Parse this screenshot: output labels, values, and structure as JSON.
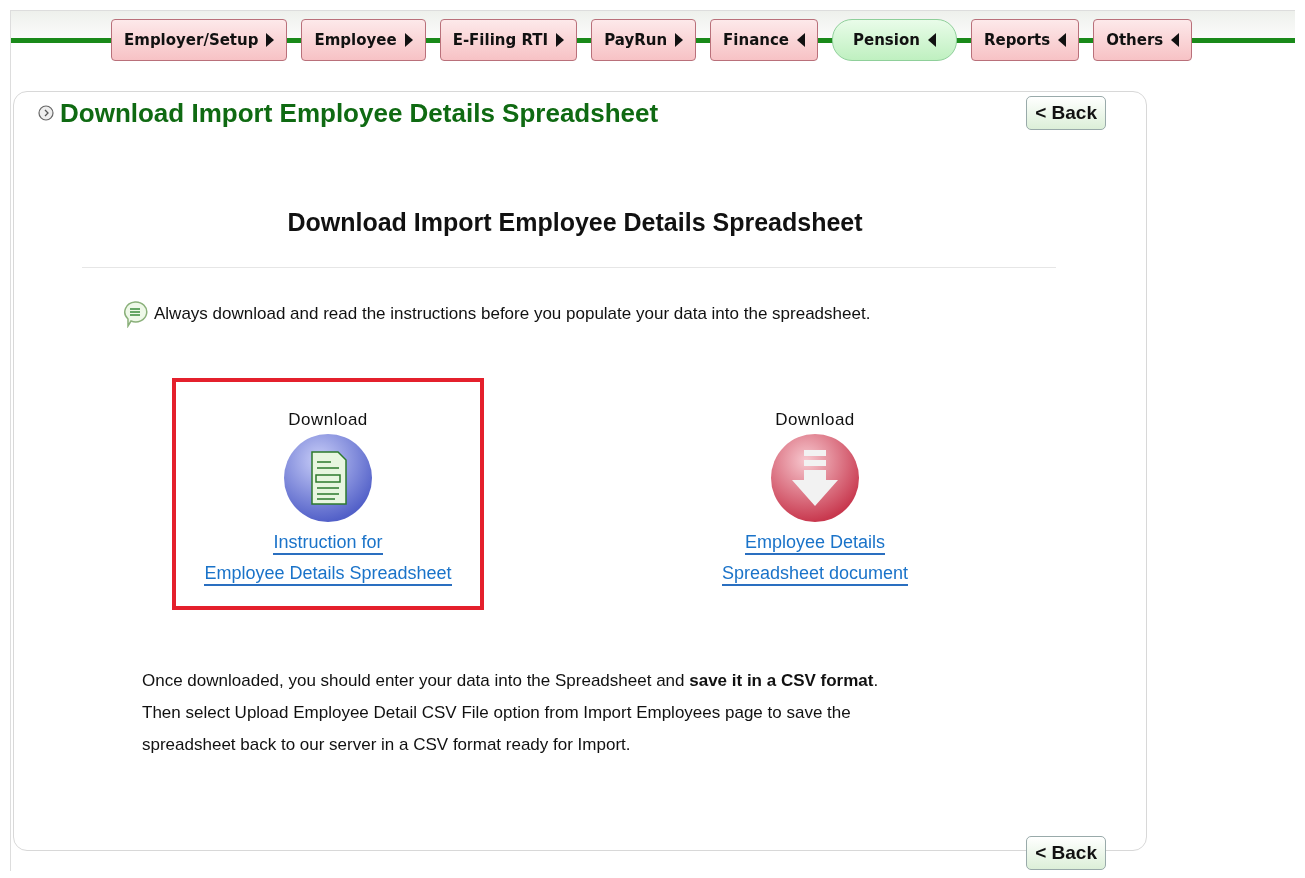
{
  "nav_tabs": [
    {
      "label": "Employer/Setup",
      "kind": "right",
      "selected": false
    },
    {
      "label": "Employee",
      "kind": "right",
      "selected": false
    },
    {
      "label": "E-Filing RTI",
      "kind": "right",
      "selected": false
    },
    {
      "label": "PayRun",
      "kind": "right",
      "selected": false
    },
    {
      "label": "Finance",
      "kind": "left",
      "selected": false
    },
    {
      "label": "Pension",
      "kind": "left",
      "selected": true
    },
    {
      "label": "Reports",
      "kind": "left",
      "selected": false
    },
    {
      "label": "Others",
      "kind": "left",
      "selected": false
    }
  ],
  "page_title": "Download Import Employee Details Spreadsheet",
  "back_button_top": "< Back",
  "heading": "Download Import Employee Details Spreadsheet",
  "note": "Always download and read the instructions before you populate your data into the spreadsheet.",
  "downloads": [
    {
      "caption": "Download",
      "kind": "document",
      "highlighted": true,
      "link_lines": [
        "Instruction for",
        "Employee Details Spreadsheet"
      ]
    },
    {
      "caption": "Download",
      "kind": "arrow",
      "highlighted": false,
      "link_lines": [
        "Employee Details",
        "Spreadsheet document"
      ]
    }
  ],
  "instructions": [
    "Once downloaded, you should enter your data into the Spreadsheet and **save it in a CSV format**.",
    "Then select Upload Employee Detail CSV File option from Import Employees page to save the",
    "spreadsheet back to our server in a CSV format ready for Import."
  ],
  "back_button_bottom": "< Back"
}
